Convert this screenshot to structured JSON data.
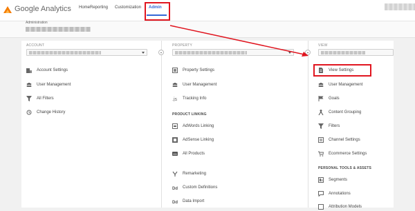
{
  "app": {
    "title": "Google Analytics"
  },
  "nav": {
    "items": [
      "Home",
      "Reporting",
      "Customization",
      "Admin"
    ],
    "active": "Admin",
    "active_color": "#3367d6"
  },
  "header": {
    "label": "Administration"
  },
  "columns": {
    "account": {
      "label": "ACCOUNT",
      "items": [
        "Account Settings",
        "User Management",
        "All Filters",
        "Change History"
      ]
    },
    "property": {
      "label": "PROPERTY",
      "items": [
        "Property Settings",
        "User Management",
        "Tracking Info"
      ],
      "section": "PRODUCT LINKING",
      "linking_items": [
        "AdWords Linking",
        "AdSense Linking",
        "All Products"
      ],
      "more_items": [
        "Remarketing",
        "Custom Definitions",
        "Data Import"
      ]
    },
    "view": {
      "label": "VIEW",
      "items": [
        "View Settings",
        "User Management",
        "Goals",
        "Content Grouping",
        "Filters",
        "Channel Settings",
        "Ecommerce Settings"
      ],
      "section": "PERSONAL TOOLS & ASSETS",
      "personal_items": [
        "Segments",
        "Annotations",
        "Attribution Models"
      ]
    }
  },
  "highlight_color": "#e0141e"
}
